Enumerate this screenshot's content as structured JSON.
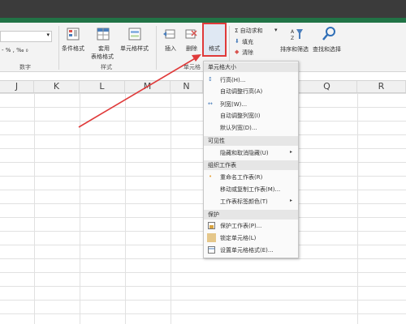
{
  "ribbon": {
    "number_format_row": "- % , ‰ ₀",
    "number_group": "数字",
    "conditional_format": "条件格式",
    "table_format_top": "套用",
    "table_format_bottom": "表格格式",
    "cell_styles": "单元格样式",
    "styles_group": "样式",
    "insert": "插入",
    "delete": "删除",
    "format": "格式",
    "cells_group": "单元格",
    "autosum": "Σ 自动求和",
    "fill": "填充",
    "clear": "清除",
    "sort_filter": "排序和筛选",
    "find_select": "查找和选择"
  },
  "columns": [
    "J",
    "K",
    "L",
    "M",
    "N",
    "Q",
    "R"
  ],
  "menu": {
    "sections": [
      {
        "title": "单元格大小"
      },
      {
        "title": "可见性"
      },
      {
        "title": "组织工作表"
      },
      {
        "title": "保护"
      }
    ],
    "items": [
      {
        "label": "行高(H)..."
      },
      {
        "label": "自动调整行高(A)"
      },
      {
        "label": "列宽(W)..."
      },
      {
        "label": "自动调整列宽(I)"
      },
      {
        "label": "默认列宽(D)..."
      },
      {
        "label": "隐藏和取消隐藏(U)"
      },
      {
        "label": "重命名工作表(R)"
      },
      {
        "label": "移动或复制工作表(M)..."
      },
      {
        "label": "工作表标签颜色(T)"
      },
      {
        "label": "保护工作表(P)..."
      },
      {
        "label": "锁定单元格(L)"
      },
      {
        "label": "设置单元格格式(E)..."
      }
    ]
  },
  "colors": {
    "excel_green": "#217346",
    "highlight_red": "#e03a3a",
    "menu_bg": "#fafafa"
  }
}
